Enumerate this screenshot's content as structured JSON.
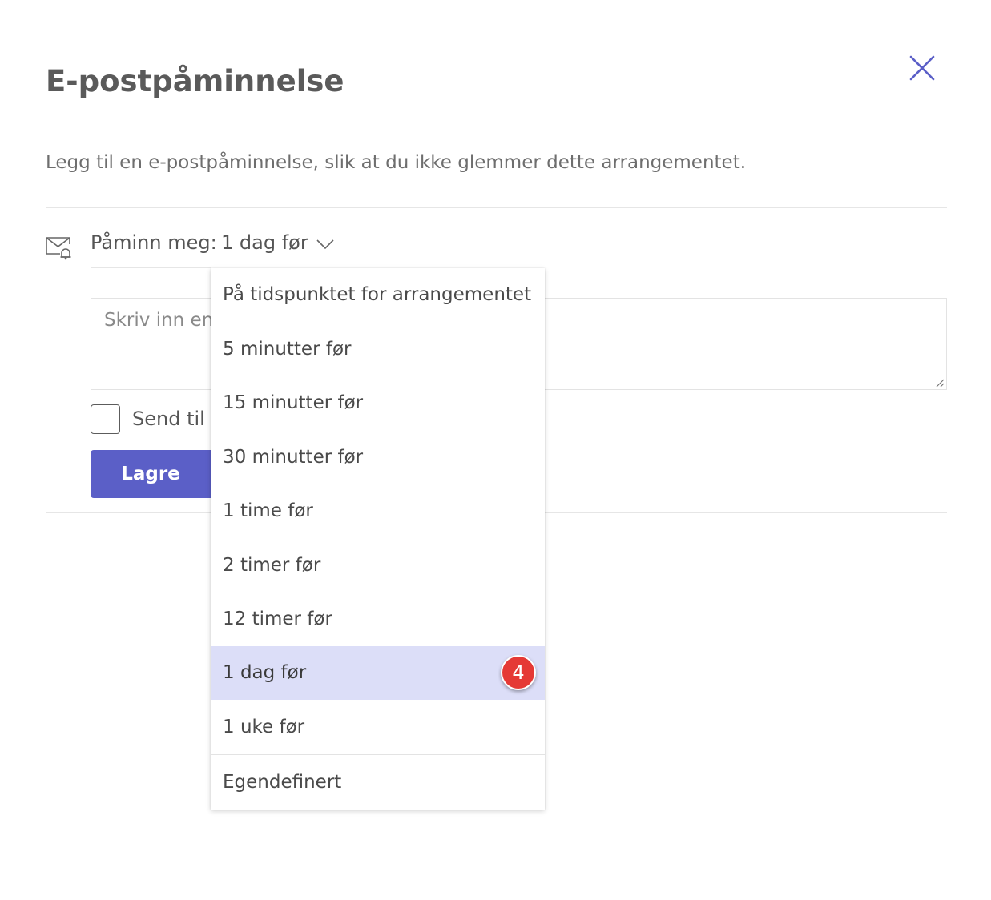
{
  "dialog": {
    "title": "E-postpåminnelse",
    "description": "Legg til en e-postpåminnelse, slik at du ikke glemmer dette arrangementet.",
    "close_icon": "close-icon"
  },
  "reminder": {
    "icon": "mail-bell-icon",
    "label": "Påminn meg:",
    "value": "1 dag før",
    "chevron_icon": "chevron-down-icon"
  },
  "message": {
    "placeholder_visible": "Skriv inn en"
  },
  "send_option": {
    "label_visible": "Send til",
    "checked": false
  },
  "actions": {
    "save_label": "Lagre"
  },
  "dropdown": {
    "options": [
      "På tidspunktet for arrangementet",
      "5 minutter før",
      "15 minutter før",
      "30 minutter før",
      "1 time før",
      "2 timer før",
      "12 timer før",
      "1 dag før",
      "1 uke før",
      "Egendefinert"
    ],
    "selected_index": 7,
    "annotation_badge": "4"
  },
  "colors": {
    "accent": "#5b5fc7",
    "selected_bg": "#dcdef8",
    "badge": "#e53935"
  }
}
